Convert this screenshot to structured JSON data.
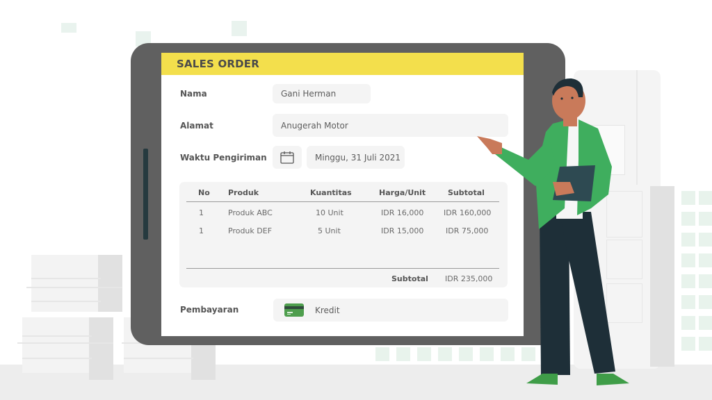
{
  "form": {
    "title": "SALES ORDER",
    "fields": {
      "nama": {
        "label": "Nama",
        "value": "Gani Herman"
      },
      "alamat": {
        "label": "Alamat",
        "value": "Anugerah Motor"
      },
      "waktu": {
        "label": "Waktu Pengiriman",
        "value": "Minggu, 31 Juli 2021",
        "icon": "calendar-icon"
      },
      "pembayaran": {
        "label": "Pembayaran",
        "value": "Kredit",
        "icon": "credit-card-icon"
      }
    },
    "table": {
      "headers": [
        "No",
        "Produk",
        "Kuantitas",
        "Harga/Unit",
        "Subtotal"
      ],
      "rows": [
        [
          "1",
          "Produk ABC",
          "10 Unit",
          "IDR 16,000",
          "IDR 160,000"
        ],
        [
          "1",
          "Produk DEF",
          "5 Unit",
          "IDR 15,000",
          "IDR 75,000"
        ]
      ],
      "footer": {
        "label": "Subtotal",
        "value": "IDR 235,000"
      }
    }
  },
  "colors": {
    "header_yellow": "#f3df4c",
    "tablet_frame": "#606060",
    "accent_green": "#3fae5e",
    "card_green": "#4e9e4d"
  }
}
